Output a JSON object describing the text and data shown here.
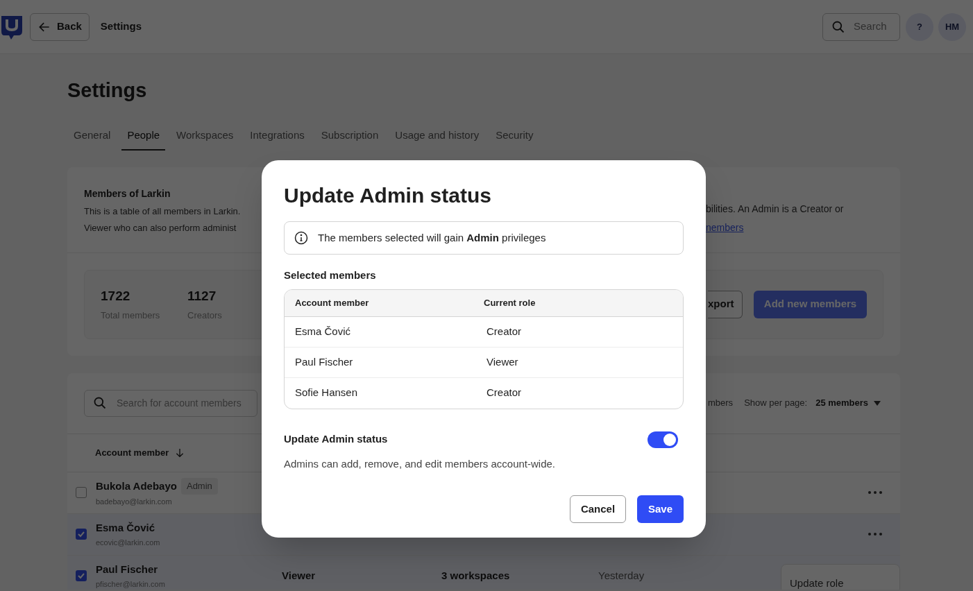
{
  "topbar": {
    "back_label": "Back",
    "title": "Settings",
    "search_placeholder": "Search",
    "help": "?",
    "avatar": "HM"
  },
  "page_title": "Settings",
  "tabs": [
    {
      "label": "General",
      "selected": false
    },
    {
      "label": "People",
      "selected": true
    },
    {
      "label": "Workspaces",
      "selected": false
    },
    {
      "label": "Integrations",
      "selected": false
    },
    {
      "label": "Subscription",
      "selected": false
    },
    {
      "label": "Usage and history",
      "selected": false
    },
    {
      "label": "Security",
      "selected": false
    }
  ],
  "members_card": {
    "title": "Members of Larkin",
    "description_left": [
      "This is a table of all members in Larkin.",
      "Viewer who can also perform administ"
    ],
    "description_right": "bilities. An Admin is a Creator or",
    "link": "nembers"
  },
  "stats": [
    {
      "value": "1722",
      "label": "Total members"
    },
    {
      "value": "1127",
      "label": "Creators"
    }
  ],
  "export_button": "xport",
  "add_button": "Add new members",
  "table_toolbar": {
    "search_placeholder": "Search for account members",
    "count_fragment": "mbers",
    "per_page_label": "Show per page:",
    "per_page_value": "25 members"
  },
  "table": {
    "sort_column": "Account member",
    "rows": [
      {
        "name": "Bukola Adebayo",
        "badge": "Admin",
        "email": "badebayo@larkin.com",
        "checked": false
      },
      {
        "name": "Esma Čović",
        "email": "ecovic@larkin.com",
        "checked": true
      },
      {
        "name": "Paul Fischer",
        "email": "pfischer@larkin.com",
        "checked": true,
        "role": "Viewer",
        "workspaces": "3 workspaces",
        "last_active": "Yesterday"
      }
    ]
  },
  "row_menu": {
    "items": [
      "Update role"
    ]
  },
  "dialog": {
    "title": "Update Admin status",
    "info": "The members selected will gain **Admin** privileges",
    "section_title": "Selected members",
    "columns": [
      "Account member",
      "Current role"
    ],
    "rows": [
      {
        "member": "Esma Čović",
        "role": "Creator"
      },
      {
        "member": "Paul Fischer",
        "role": "Viewer"
      },
      {
        "member": "Sofie Hansen",
        "role": "Creator"
      }
    ],
    "toggle": {
      "label": "Update Admin status",
      "on": true,
      "description": "Admins can add, remove, and edit members account-wide."
    },
    "cancel": "Cancel",
    "save": "Save"
  }
}
